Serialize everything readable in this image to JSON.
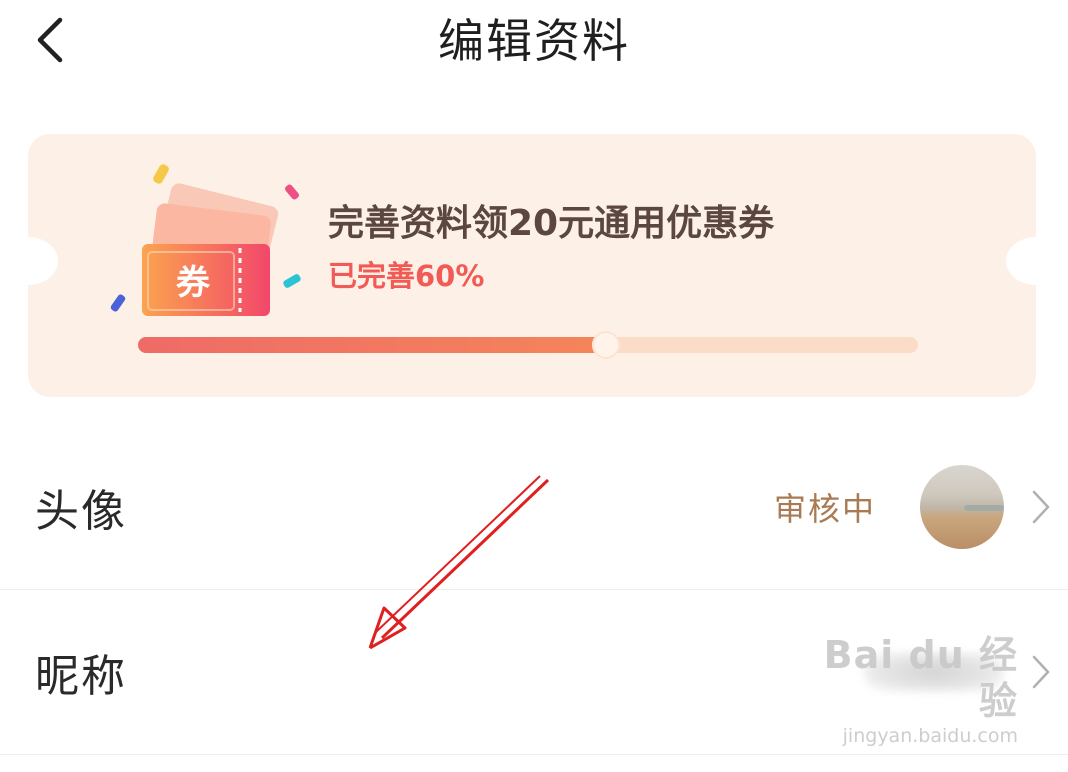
{
  "header": {
    "title": "编辑资料",
    "back_icon": "chevron-left-icon"
  },
  "banner": {
    "title": "完善资料领20元通用优惠券",
    "subtitle": "已完善60%",
    "progress_fraction": 0.6,
    "coupon_text": "券"
  },
  "rows": [
    {
      "label": "头像",
      "status": "审核中",
      "chevron_icon": "chevron-right-icon"
    },
    {
      "label": "昵称",
      "chevron_icon": "chevron-right-icon"
    }
  ],
  "watermark": {
    "brand": "Bai du 经验",
    "url": "jingyan.baidu.com"
  },
  "colors": {
    "accent_red": "#f25a56",
    "status_brown": "#a97a53",
    "banner_bg": "#fdf1e7",
    "arrow_red": "#e02020"
  }
}
